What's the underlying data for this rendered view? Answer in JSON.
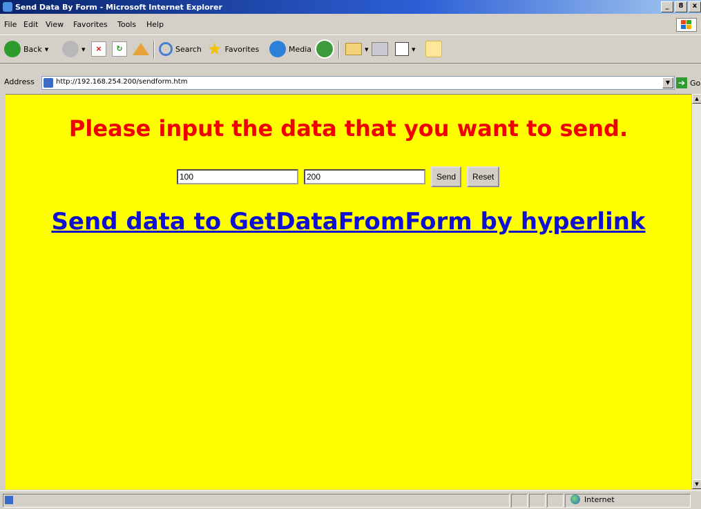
{
  "window": {
    "title": "Send Data By Form - Microsoft Internet Explorer",
    "controls": [
      "_",
      "8",
      "x"
    ]
  },
  "menu": [
    "File",
    "Edit",
    "View",
    "Favorites",
    "Tools",
    "Help"
  ],
  "toolbar": {
    "back_label": "Back",
    "search_label": "Search",
    "favorites_label": "Favorites",
    "media_label": "Media"
  },
  "address": {
    "label": "Address",
    "url": "http://192.168.254.200/sendform.htm",
    "go_label": "Go"
  },
  "page": {
    "heading": "Please input the data that you want to send.",
    "field1_value": "100",
    "field2_value": "200",
    "send_label": "Send",
    "reset_label": "Reset",
    "link_text": "Send data to GetDataFromForm by hyperlink"
  },
  "colors": {
    "page_background": "#ffff00",
    "heading": "#f00000",
    "link": "#1010d0"
  },
  "status": {
    "zone": "Internet"
  }
}
